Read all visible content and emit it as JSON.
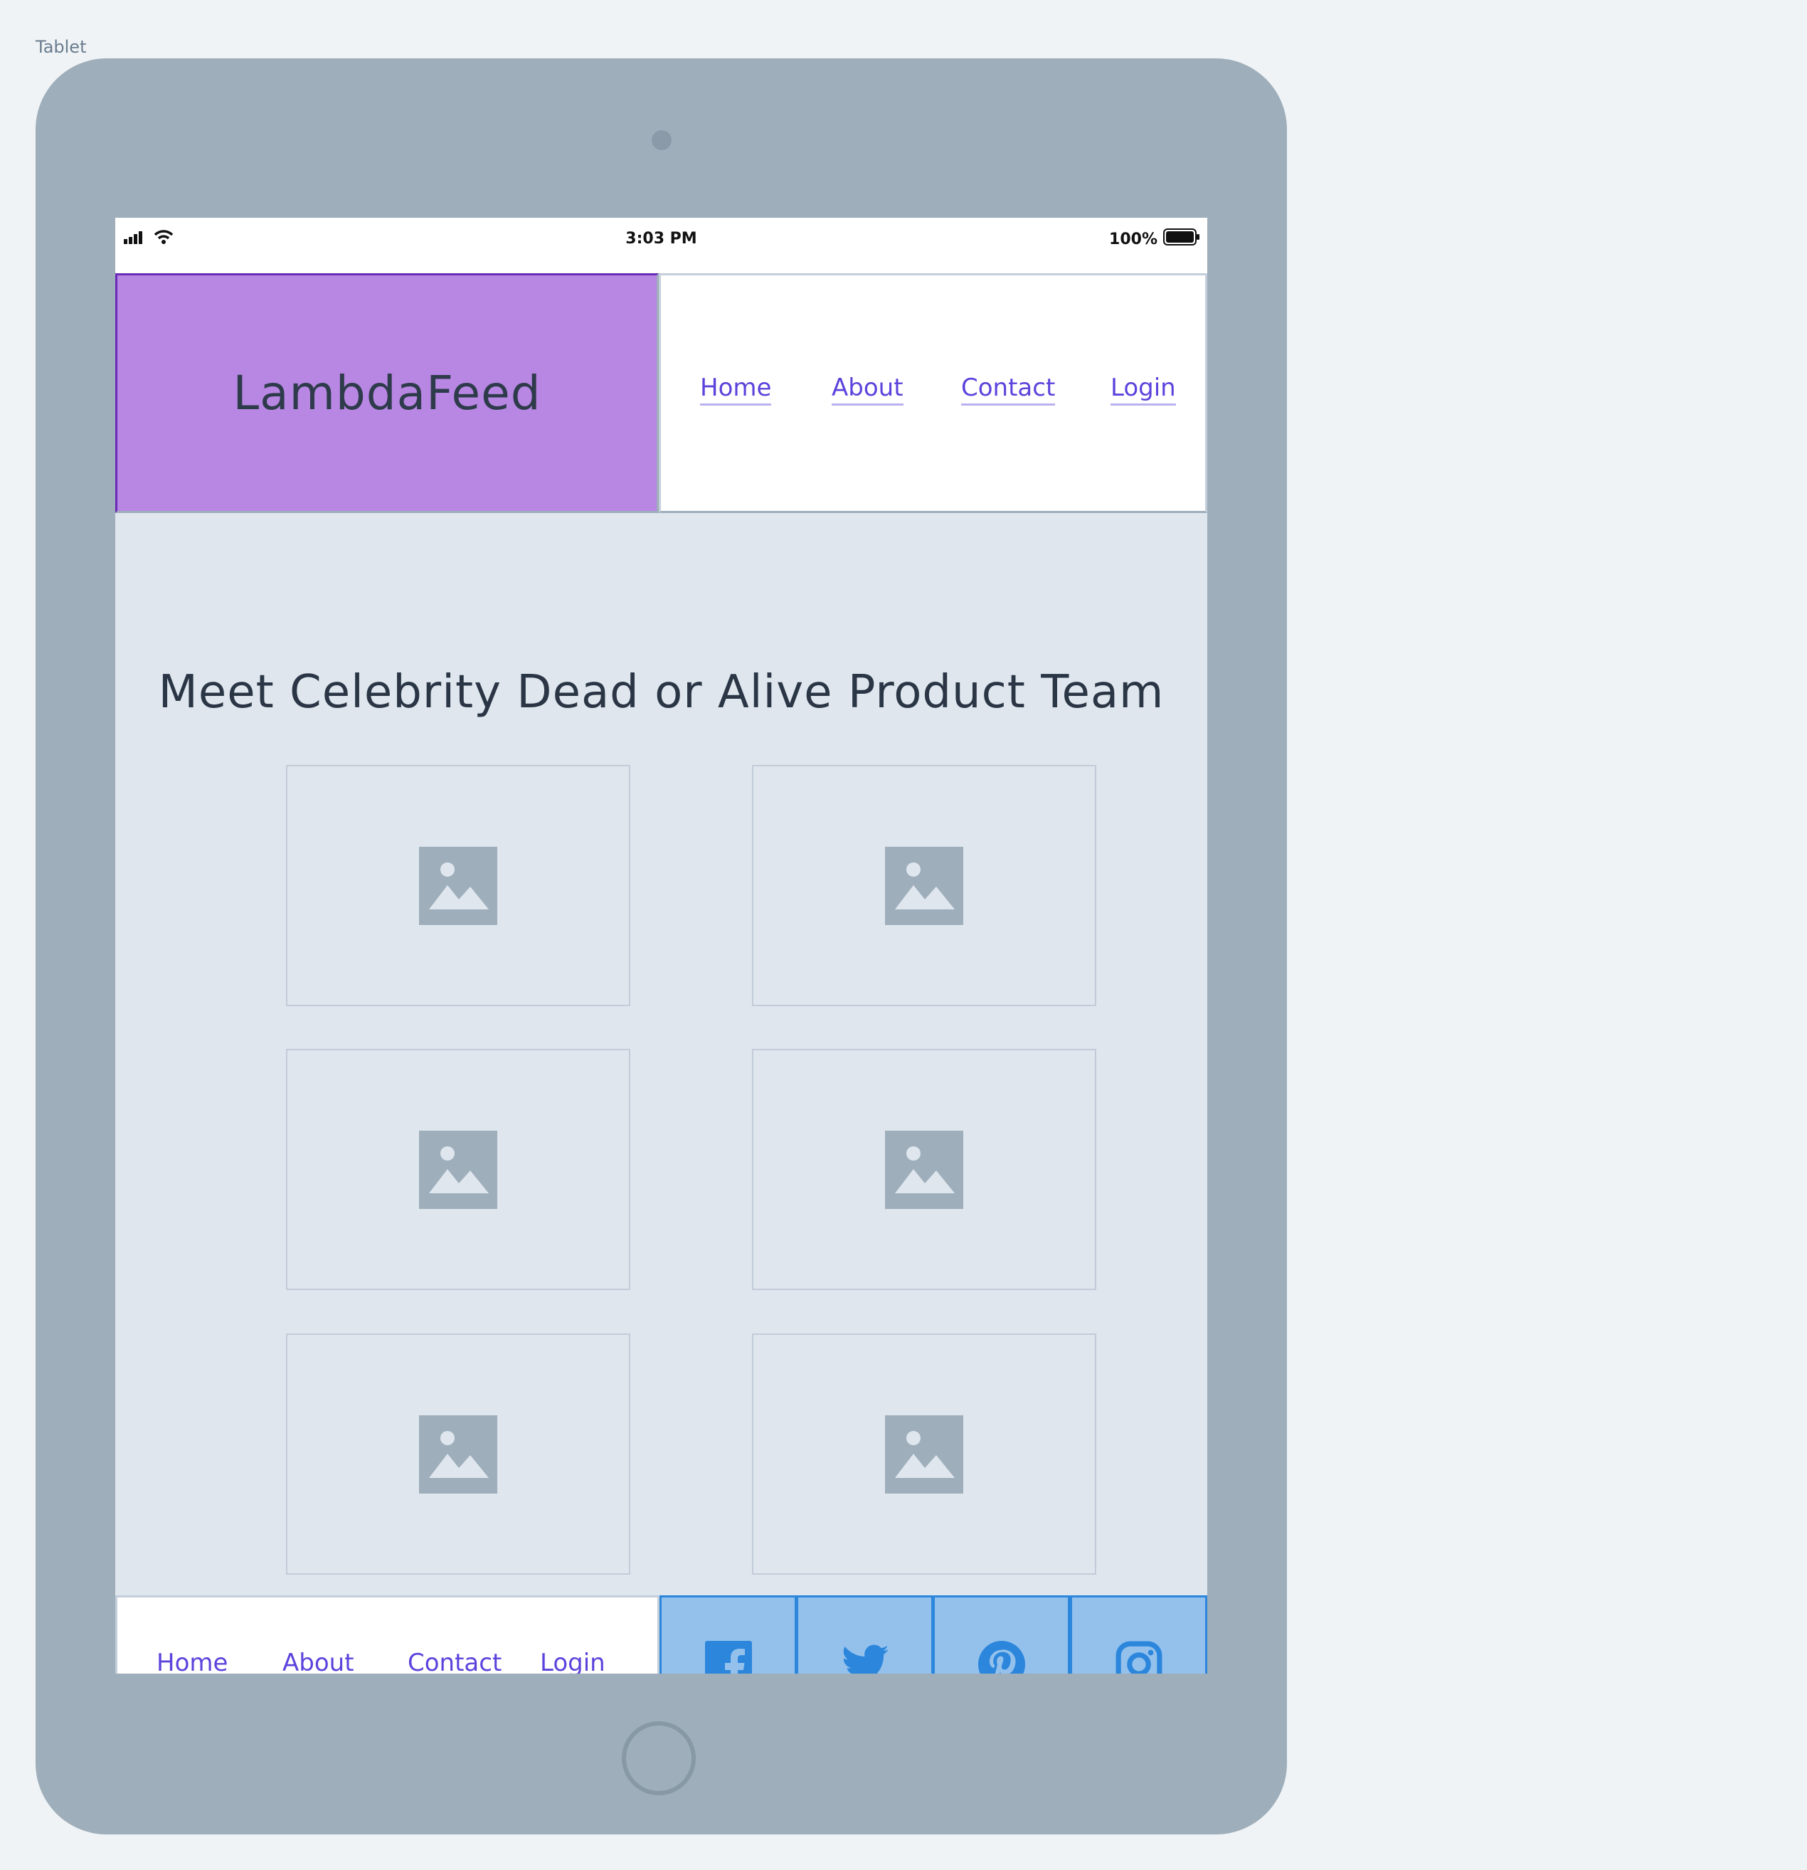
{
  "frame": {
    "label": "Tablet"
  },
  "status_bar": {
    "time": "3:03 PM",
    "battery": "100%",
    "icons": [
      "signal-icon",
      "wifi-icon",
      "battery-icon"
    ]
  },
  "header": {
    "brand": "LambdaFeed",
    "nav": [
      {
        "label": "Home"
      },
      {
        "label": "About"
      },
      {
        "label": "Contact"
      },
      {
        "label": "Login"
      }
    ]
  },
  "main": {
    "title": "Meet Celebrity Dead or Alive Product Team",
    "team_images": [
      {
        "icon": "image-placeholder-icon"
      },
      {
        "icon": "image-placeholder-icon"
      },
      {
        "icon": "image-placeholder-icon"
      },
      {
        "icon": "image-placeholder-icon"
      },
      {
        "icon": "image-placeholder-icon"
      },
      {
        "icon": "image-placeholder-icon"
      }
    ]
  },
  "footer": {
    "nav": [
      {
        "label": "Home"
      },
      {
        "label": "About"
      },
      {
        "label": "Contact"
      },
      {
        "label": "Login"
      }
    ],
    "social": [
      {
        "icon": "facebook-icon"
      },
      {
        "icon": "twitter-icon"
      },
      {
        "icon": "pinterest-icon"
      },
      {
        "icon": "instagram-icon"
      }
    ]
  },
  "colors": {
    "brand_bg": "#b887e3",
    "brand_border": "#6a2ab7",
    "link": "#5b43dc",
    "social_bg": "#94c1ec",
    "social_icon": "#2b86dc",
    "device": "#9eaeba",
    "screen_bg": "#dfe6ee",
    "placeholder": "#9eaeba"
  }
}
